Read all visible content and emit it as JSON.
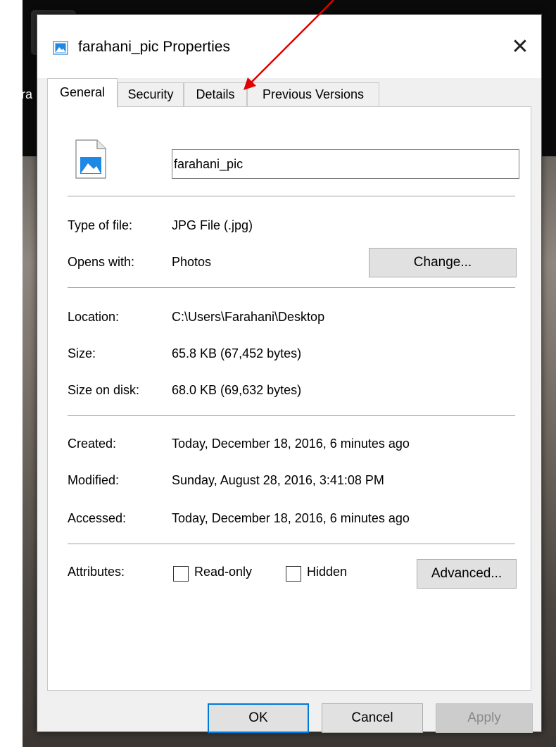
{
  "desktop": {
    "icon_label": "fara"
  },
  "window": {
    "title": "farahani_pic Properties",
    "close_glyph": "✕",
    "tabs": [
      {
        "label": "General"
      },
      {
        "label": "Security"
      },
      {
        "label": "Details"
      },
      {
        "label": "Previous Versions"
      }
    ]
  },
  "general": {
    "filename": "farahani_pic",
    "type_label": "Type of file:",
    "type_value": "JPG File (.jpg)",
    "opens_label": "Opens with:",
    "opens_value": "Photos",
    "change_button": "Change...",
    "location_label": "Location:",
    "location_value": "C:\\Users\\Farahani\\Desktop",
    "size_label": "Size:",
    "size_value": "65.8 KB (67,452 bytes)",
    "size_disk_label": "Size on disk:",
    "size_disk_value": "68.0 KB (69,632 bytes)",
    "created_label": "Created:",
    "created_value": "Today, December 18, 2016, 6 minutes ago",
    "modified_label": "Modified:",
    "modified_value": "Sunday, August 28, 2016, 3:41:08 PM",
    "accessed_label": "Accessed:",
    "accessed_value": "Today, December 18, 2016, 6 minutes ago",
    "attributes_label": "Attributes:",
    "readonly_label": "Read-only",
    "hidden_label": "Hidden",
    "advanced_button": "Advanced..."
  },
  "footer": {
    "ok": "OK",
    "cancel": "Cancel",
    "apply": "Apply"
  },
  "colors": {
    "accent": "#0078d7",
    "annotation_arrow": "#e00000"
  }
}
